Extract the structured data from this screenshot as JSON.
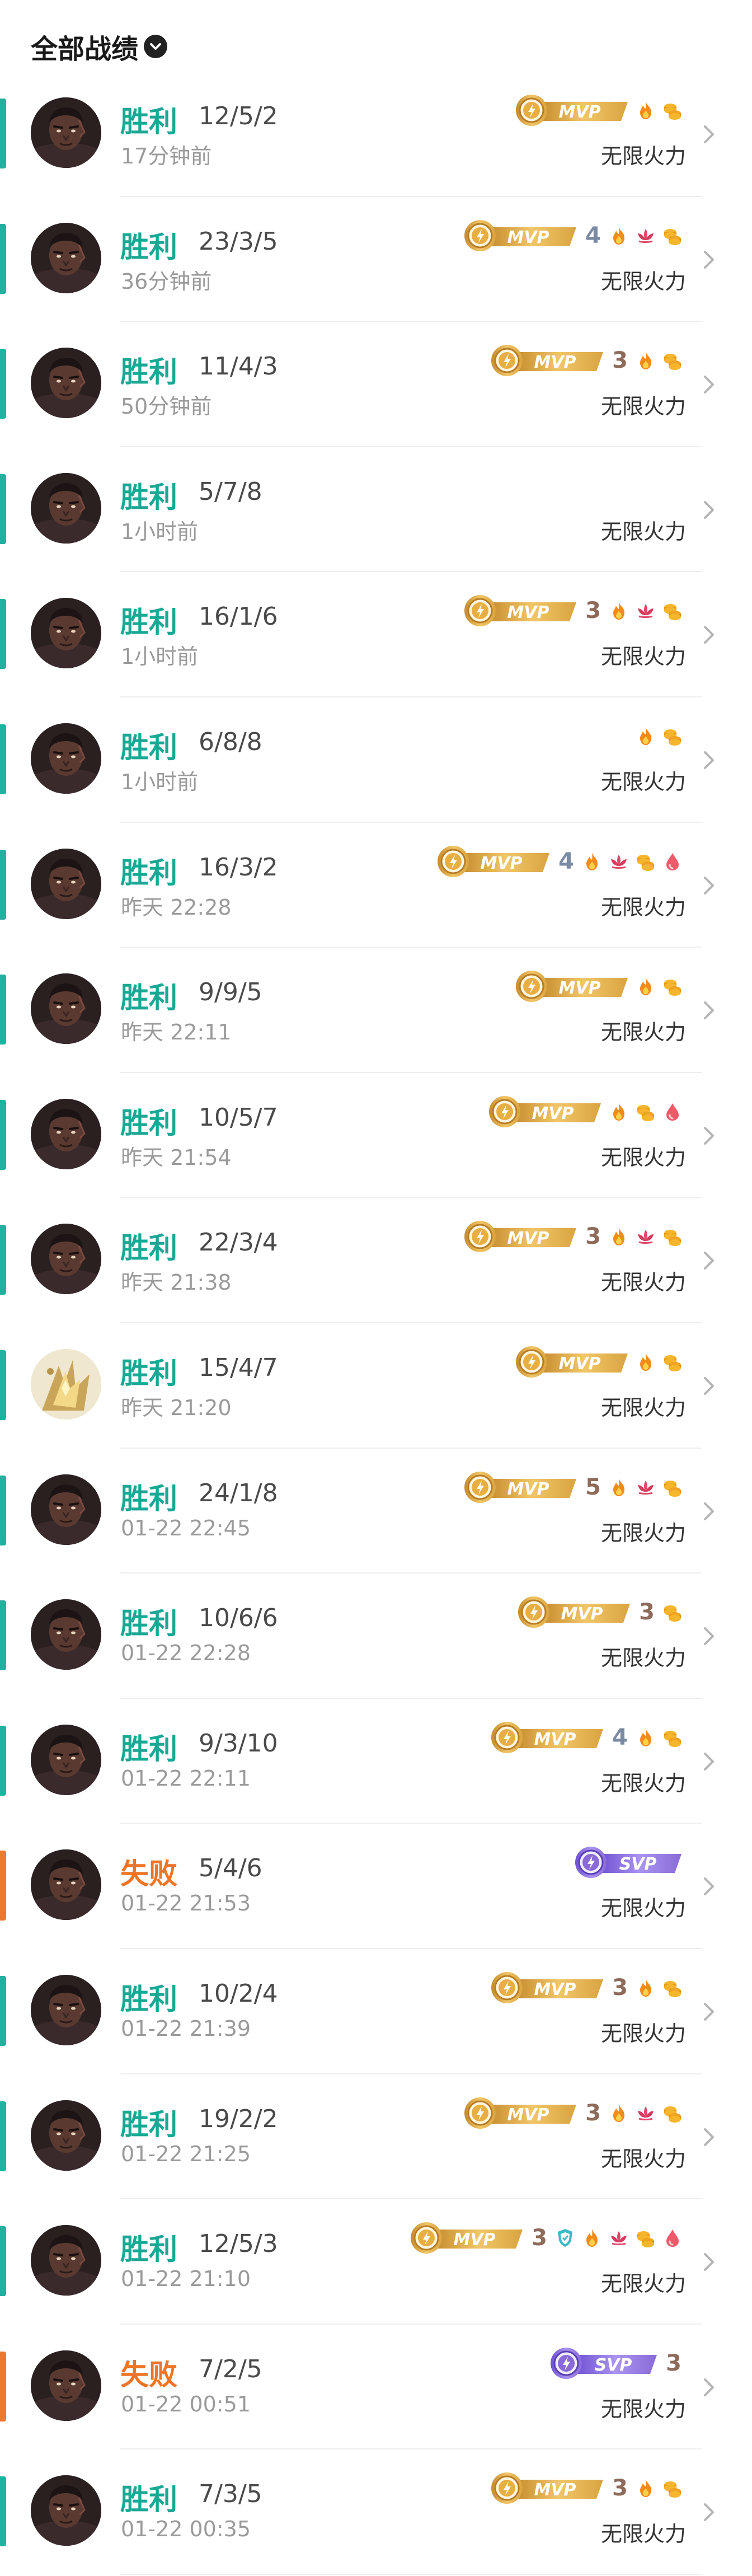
{
  "header": {
    "title": "全部战绩"
  },
  "colors": {
    "win": "#1aa895",
    "lose": "#ef7424",
    "mvp_gold": "#d9a441",
    "svp_purple": "#8a6ad8"
  },
  "matches": [
    {
      "result": "胜利",
      "kda": "12/5/2",
      "time": "17分钟前",
      "mode": "无限火力",
      "win": true,
      "avatar": "hero-dark",
      "badge": "MVP",
      "rank": "",
      "icons": [
        "fire-icon",
        "coins-icon"
      ]
    },
    {
      "result": "胜利",
      "kda": "23/3/5",
      "time": "36分钟前",
      "mode": "无限火力",
      "win": true,
      "avatar": "hero-dark",
      "badge": "MVP",
      "rank": "4",
      "icons": [
        "fire-icon",
        "lotus-icon",
        "coins-icon"
      ]
    },
    {
      "result": "胜利",
      "kda": "11/4/3",
      "time": "50分钟前",
      "mode": "无限火力",
      "win": true,
      "avatar": "hero-dark",
      "badge": "MVP",
      "rank": "3",
      "icons": [
        "fire-icon",
        "coins-icon"
      ]
    },
    {
      "result": "胜利",
      "kda": "5/7/8",
      "time": "1小时前",
      "mode": "无限火力",
      "win": true,
      "avatar": "hero-dark",
      "badge": "",
      "rank": "",
      "icons": []
    },
    {
      "result": "胜利",
      "kda": "16/1/6",
      "time": "1小时前",
      "mode": "无限火力",
      "win": true,
      "avatar": "hero-dark",
      "badge": "MVP",
      "rank": "3",
      "icons": [
        "fire-icon",
        "lotus-icon",
        "coins-icon"
      ]
    },
    {
      "result": "胜利",
      "kda": "6/8/8",
      "time": "1小时前",
      "mode": "无限火力",
      "win": true,
      "avatar": "hero-dark",
      "badge": "",
      "rank": "",
      "icons": [
        "fire-icon",
        "coins-icon"
      ]
    },
    {
      "result": "胜利",
      "kda": "16/3/2",
      "time": "昨天 22:28",
      "mode": "无限火力",
      "win": true,
      "avatar": "hero-dark",
      "badge": "MVP",
      "rank": "4",
      "icons": [
        "fire-icon",
        "lotus-icon",
        "coins-icon",
        "drop-icon"
      ]
    },
    {
      "result": "胜利",
      "kda": "9/9/5",
      "time": "昨天 22:11",
      "mode": "无限火力",
      "win": true,
      "avatar": "hero-dark",
      "badge": "MVP",
      "rank": "",
      "icons": [
        "fire-icon",
        "coins-icon"
      ]
    },
    {
      "result": "胜利",
      "kda": "10/5/7",
      "time": "昨天 21:54",
      "mode": "无限火力",
      "win": true,
      "avatar": "hero-dark",
      "badge": "MVP",
      "rank": "",
      "icons": [
        "fire-icon",
        "coins-icon",
        "drop-icon"
      ]
    },
    {
      "result": "胜利",
      "kda": "22/3/4",
      "time": "昨天 21:38",
      "mode": "无限火力",
      "win": true,
      "avatar": "hero-dark",
      "badge": "MVP",
      "rank": "3",
      "icons": [
        "fire-icon",
        "lotus-icon",
        "coins-icon"
      ]
    },
    {
      "result": "胜利",
      "kda": "15/4/7",
      "time": "昨天 21:20",
      "mode": "无限火力",
      "win": true,
      "avatar": "hero-golden",
      "badge": "MVP",
      "rank": "",
      "icons": [
        "fire-icon",
        "coins-icon"
      ]
    },
    {
      "result": "胜利",
      "kda": "24/1/8",
      "time": "01-22 22:45",
      "mode": "无限火力",
      "win": true,
      "avatar": "hero-dark",
      "badge": "MVP",
      "rank": "5",
      "icons": [
        "fire-icon",
        "lotus-icon",
        "coins-icon"
      ]
    },
    {
      "result": "胜利",
      "kda": "10/6/6",
      "time": "01-22 22:28",
      "mode": "无限火力",
      "win": true,
      "avatar": "hero-dark",
      "badge": "MVP",
      "rank": "3",
      "icons": [
        "coins-icon"
      ]
    },
    {
      "result": "胜利",
      "kda": "9/3/10",
      "time": "01-22 22:11",
      "mode": "无限火力",
      "win": true,
      "avatar": "hero-dark",
      "badge": "MVP",
      "rank": "4",
      "icons": [
        "fire-icon",
        "coins-icon"
      ]
    },
    {
      "result": "失败",
      "kda": "5/4/6",
      "time": "01-22 21:53",
      "mode": "无限火力",
      "win": false,
      "avatar": "hero-dark",
      "badge": "SVP",
      "rank": "",
      "icons": []
    },
    {
      "result": "胜利",
      "kda": "10/2/4",
      "time": "01-22 21:39",
      "mode": "无限火力",
      "win": true,
      "avatar": "hero-dark",
      "badge": "MVP",
      "rank": "3",
      "icons": [
        "fire-icon",
        "coins-icon"
      ]
    },
    {
      "result": "胜利",
      "kda": "19/2/2",
      "time": "01-22 21:25",
      "mode": "无限火力",
      "win": true,
      "avatar": "hero-dark",
      "badge": "MVP",
      "rank": "3",
      "icons": [
        "fire-icon",
        "lotus-icon",
        "coins-icon"
      ]
    },
    {
      "result": "胜利",
      "kda": "12/5/3",
      "time": "01-22 21:10",
      "mode": "无限火力",
      "win": true,
      "avatar": "hero-dark",
      "badge": "MVP",
      "rank": "3",
      "icons": [
        "shield-icon",
        "fire-icon",
        "lotus-icon",
        "coins-icon",
        "drop-icon"
      ]
    },
    {
      "result": "失败",
      "kda": "7/2/5",
      "time": "01-22 00:51",
      "mode": "无限火力",
      "win": false,
      "avatar": "hero-dark",
      "badge": "SVP",
      "rank": "3",
      "icons": []
    },
    {
      "result": "胜利",
      "kda": "7/3/5",
      "time": "01-22 00:35",
      "mode": "无限火力",
      "win": true,
      "avatar": "hero-dark",
      "badge": "MVP",
      "rank": "3",
      "icons": [
        "fire-icon",
        "coins-icon"
      ]
    }
  ]
}
